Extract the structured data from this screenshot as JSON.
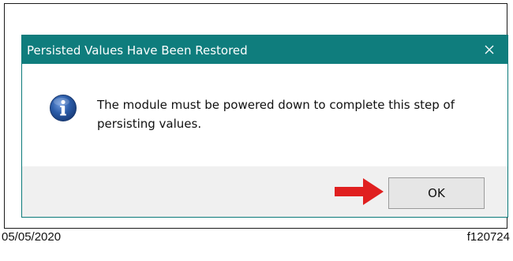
{
  "dialog": {
    "title": "Persisted Values Have Been Restored",
    "message": "The module must be powered down to complete this step of persisting values.",
    "ok_label": "OK",
    "close_icon": "close-icon",
    "info_icon": "info-icon"
  },
  "annotation": {
    "arrow_icon": "arrow-right-icon",
    "arrow_color": "#e02020"
  },
  "caption": {
    "date": "05/05/2020",
    "figure_id": "f120724"
  },
  "colors": {
    "titlebar": "#0f7d7d",
    "footer": "#f0f0f0",
    "info_blue": "#2b5ca8"
  }
}
